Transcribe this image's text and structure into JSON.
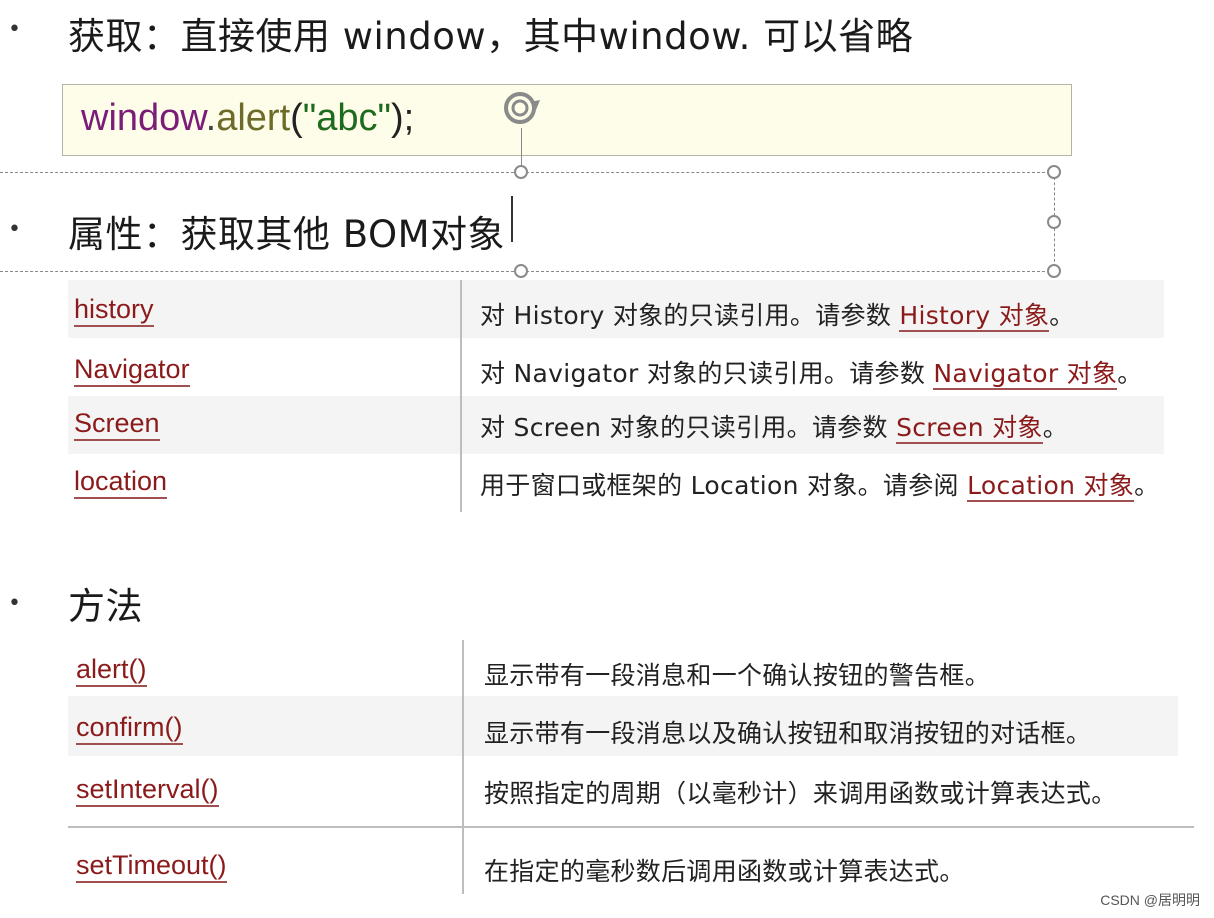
{
  "section_get": {
    "heading": "获取：直接使用 window，其中window. 可以省略"
  },
  "code": {
    "obj": "window",
    "dot": ".",
    "fn": "alert",
    "open": "(",
    "str": "\"abc\"",
    "close": ");"
  },
  "section_props": {
    "heading": "属性：获取其他 BOM对象",
    "rows": [
      {
        "name": "history",
        "desc": "对 History 对象的只读引用。请参数 ",
        "link": "History 对象",
        "tail": "。"
      },
      {
        "name": "Navigator",
        "desc": "对 Navigator 对象的只读引用。请参数 ",
        "link": "Navigator 对象",
        "tail": "。"
      },
      {
        "name": "Screen",
        "desc": "对 Screen 对象的只读引用。请参数 ",
        "link": "Screen 对象",
        "tail": "。"
      },
      {
        "name": "location",
        "desc": "用于窗口或框架的 Location 对象。请参阅 ",
        "link": "Location 对象",
        "tail": "。"
      }
    ]
  },
  "section_methods": {
    "heading": "方法",
    "rows": [
      {
        "name": "alert()",
        "desc": "显示带有一段消息和一个确认按钮的警告框。"
      },
      {
        "name": "confirm()",
        "desc": "显示带有一段消息以及确认按钮和取消按钮的对话框。"
      },
      {
        "name": "setInterval()",
        "desc": "按照指定的周期（以毫秒计）来调用函数或计算表达式。"
      },
      {
        "name": "setTimeout()",
        "desc": "在指定的毫秒数后调用函数或计算表达式。"
      }
    ]
  },
  "bullet": "•",
  "watermark": "CSDN @居明明"
}
